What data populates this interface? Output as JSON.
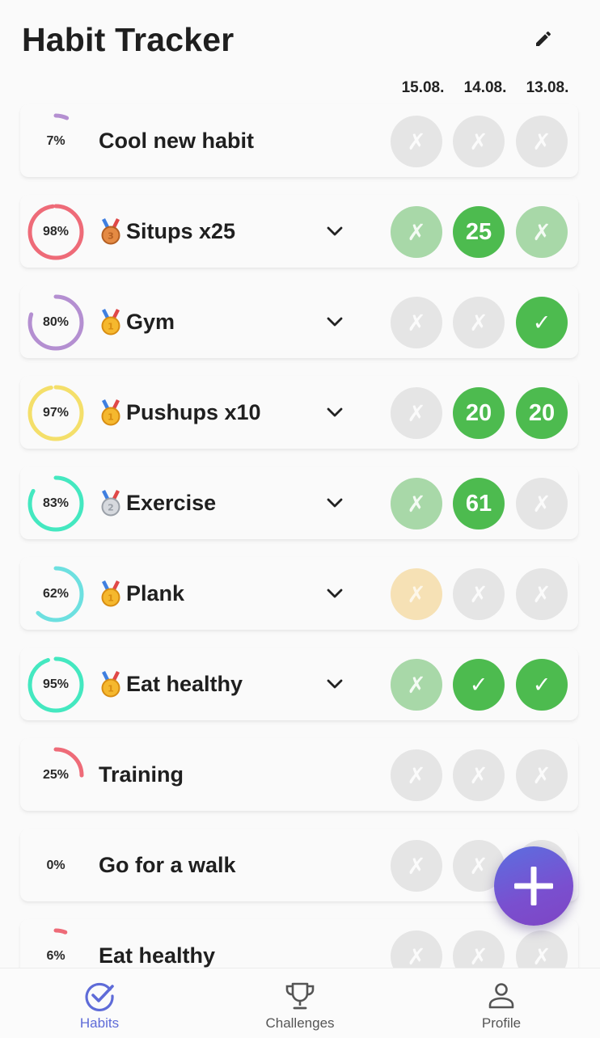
{
  "header": {
    "title": "Habit Tracker",
    "edit_icon": "pencil-icon"
  },
  "dates": [
    "15.08.",
    "14.08.",
    "13.08."
  ],
  "habits": [
    {
      "percent": "7%",
      "progress": 0.07,
      "ring_color": "#b48fd1",
      "medal": null,
      "name": "Cool new habit",
      "expandable": false,
      "days": [
        {
          "state": "none",
          "text": "✗"
        },
        {
          "state": "none",
          "text": "✗"
        },
        {
          "state": "none",
          "text": "✗"
        }
      ]
    },
    {
      "percent": "98%",
      "progress": 0.98,
      "ring_color": "#ee6b78",
      "medal": "bronze",
      "medal_text": "3",
      "name": "Situps x25",
      "expandable": true,
      "days": [
        {
          "state": "missed",
          "text": "✗"
        },
        {
          "state": "count",
          "text": "25"
        },
        {
          "state": "missed",
          "text": "✗"
        }
      ]
    },
    {
      "percent": "80%",
      "progress": 0.8,
      "ring_color": "#b48fd1",
      "medal": "gold",
      "medal_text": "1",
      "name": "Gym",
      "expandable": true,
      "days": [
        {
          "state": "none",
          "text": "✗"
        },
        {
          "state": "none",
          "text": "✗"
        },
        {
          "state": "done",
          "text": "✓"
        }
      ]
    },
    {
      "percent": "97%",
      "progress": 0.97,
      "ring_color": "#f4df6a",
      "medal": "gold",
      "medal_text": "1",
      "name": "Pushups x10",
      "expandable": true,
      "days": [
        {
          "state": "none",
          "text": "✗"
        },
        {
          "state": "count",
          "text": "20"
        },
        {
          "state": "count",
          "text": "20"
        }
      ]
    },
    {
      "percent": "83%",
      "progress": 0.83,
      "ring_color": "#44e8c0",
      "medal": "silver",
      "medal_text": "2",
      "name": "Exercise",
      "expandable": true,
      "days": [
        {
          "state": "missed",
          "text": "✗"
        },
        {
          "state": "count",
          "text": "61"
        },
        {
          "state": "none",
          "text": "✗"
        }
      ]
    },
    {
      "percent": "62%",
      "progress": 0.62,
      "ring_color": "#6de0e0",
      "medal": "gold",
      "medal_text": "1",
      "name": "Plank",
      "expandable": true,
      "days": [
        {
          "state": "warn",
          "text": "✗"
        },
        {
          "state": "none",
          "text": "✗"
        },
        {
          "state": "none",
          "text": "✗"
        }
      ]
    },
    {
      "percent": "95%",
      "progress": 0.95,
      "ring_color": "#44e8c0",
      "medal": "gold",
      "medal_text": "1",
      "name": "Eat healthy",
      "expandable": true,
      "days": [
        {
          "state": "missed",
          "text": "✗"
        },
        {
          "state": "done",
          "text": "✓"
        },
        {
          "state": "done",
          "text": "✓"
        }
      ]
    },
    {
      "percent": "25%",
      "progress": 0.25,
      "ring_color": "#ee6b78",
      "medal": null,
      "name": "Training",
      "expandable": false,
      "days": [
        {
          "state": "none",
          "text": "✗"
        },
        {
          "state": "none",
          "text": "✗"
        },
        {
          "state": "none",
          "text": "✗"
        }
      ]
    },
    {
      "percent": "0%",
      "progress": 0.0,
      "ring_color": "#cccccc",
      "medal": null,
      "name": "Go for a walk",
      "expandable": false,
      "days": [
        {
          "state": "none",
          "text": "✗"
        },
        {
          "state": "none",
          "text": "✗"
        },
        {
          "state": "none",
          "text": "✗"
        }
      ]
    },
    {
      "percent": "6%",
      "progress": 0.06,
      "ring_color": "#ee6b78",
      "medal": null,
      "name": "Eat healthy",
      "expandable": false,
      "days": [
        {
          "state": "none",
          "text": "✗"
        },
        {
          "state": "none",
          "text": "✗"
        },
        {
          "state": "none",
          "text": "✗"
        }
      ]
    }
  ],
  "fab": {
    "icon": "plus-icon"
  },
  "nav": {
    "items": [
      {
        "label": "Habits",
        "icon": "check-circle-icon",
        "active": true
      },
      {
        "label": "Challenges",
        "icon": "trophy-icon",
        "active": false
      },
      {
        "label": "Profile",
        "icon": "person-icon",
        "active": false
      }
    ],
    "active_color": "#5e6bd8"
  }
}
